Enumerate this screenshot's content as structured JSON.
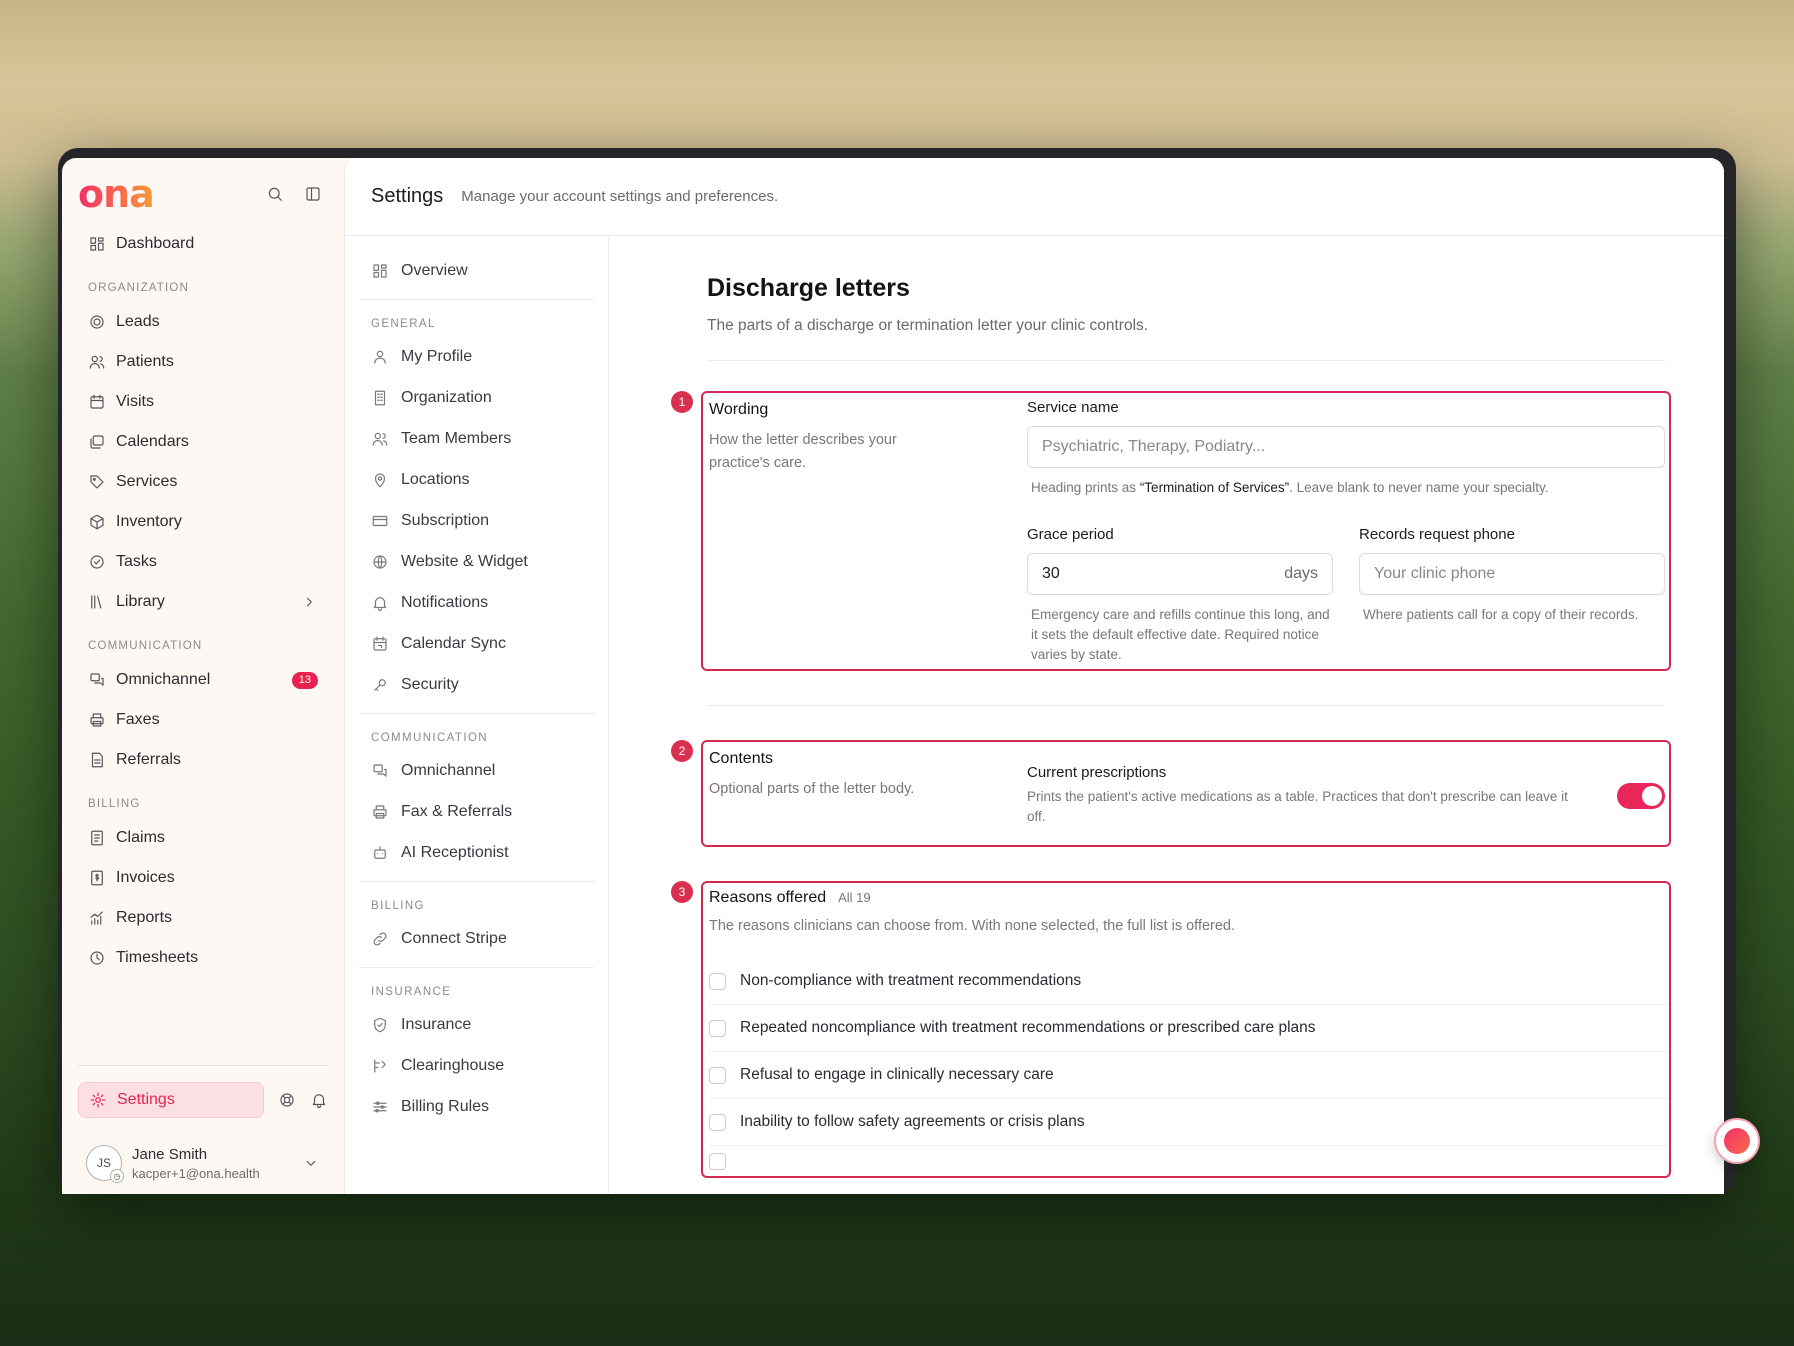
{
  "brand": {
    "logo": "ona"
  },
  "sidebar": {
    "dashboard": "Dashboard",
    "sections": [
      {
        "title": "ORGANIZATION",
        "items": [
          {
            "label": "Leads",
            "icon": "target-icon"
          },
          {
            "label": "Patients",
            "icon": "users-icon"
          },
          {
            "label": "Visits",
            "icon": "calendar-icon"
          },
          {
            "label": "Calendars",
            "icon": "calendars-icon"
          },
          {
            "label": "Services",
            "icon": "tag-icon"
          },
          {
            "label": "Inventory",
            "icon": "box-icon"
          },
          {
            "label": "Tasks",
            "icon": "check-circle-icon"
          },
          {
            "label": "Library",
            "icon": "library-icon"
          }
        ]
      },
      {
        "title": "COMMUNICATION",
        "items": [
          {
            "label": "Omnichannel",
            "icon": "chat-icon",
            "badge": "13"
          },
          {
            "label": "Faxes",
            "icon": "printer-icon"
          },
          {
            "label": "Referrals",
            "icon": "file-icon"
          }
        ]
      },
      {
        "title": "BILLING",
        "items": [
          {
            "label": "Claims",
            "icon": "file-list-icon"
          },
          {
            "label": "Invoices",
            "icon": "dollar-file-icon"
          },
          {
            "label": "Reports",
            "icon": "chart-icon"
          },
          {
            "label": "Timesheets",
            "icon": "clock-icon"
          }
        ]
      }
    ],
    "settings_label": "Settings",
    "user": {
      "initials": "JS",
      "name": "Jane Smith",
      "email": "kacper+1@ona.health"
    }
  },
  "header": {
    "title": "Settings",
    "subtitle": "Manage your account settings and preferences."
  },
  "subnav": {
    "overview": "Overview",
    "general_title": "GENERAL",
    "general": [
      "My Profile",
      "Organization",
      "Team Members",
      "Locations",
      "Subscription",
      "Website & Widget",
      "Notifications",
      "Calendar Sync",
      "Security"
    ],
    "communication_title": "COMMUNICATION",
    "communication": [
      "Omnichannel",
      "Fax & Referrals",
      "AI Receptionist"
    ],
    "billing_title": "BILLING",
    "billing": [
      "Connect Stripe"
    ],
    "insurance_title": "INSURANCE",
    "insurance": [
      "Insurance",
      "Clearinghouse",
      "Billing Rules"
    ]
  },
  "content": {
    "title": "Discharge letters",
    "subtitle": "The parts of a discharge or termination letter your clinic controls.",
    "wording": {
      "num": "1",
      "title": "Wording",
      "desc": "How the letter describes your practice's care.",
      "service_label": "Service name",
      "service_placeholder": "Psychiatric, Therapy, Podiatry...",
      "service_help_pre": "Heading prints as ",
      "service_help_bold": "“Termination of Services”",
      "service_help_post": ". Leave blank to never name your specialty.",
      "grace_label": "Grace period",
      "grace_value": "30",
      "grace_suffix": "days",
      "grace_help": "Emergency care and refills continue this long, and it sets the default effective date. Required notice varies by state.",
      "phone_label": "Records request phone",
      "phone_placeholder": "Your clinic phone",
      "phone_help": "Where patients call for a copy of their records."
    },
    "contents": {
      "num": "2",
      "title": "Contents",
      "desc": "Optional parts of the letter body.",
      "pres_label": "Current prescriptions",
      "pres_help": "Prints the patient's active medications as a table. Practices that don't prescribe can leave it off.",
      "pres_on": true
    },
    "reasons": {
      "num": "3",
      "title": "Reasons offered",
      "count": "All 19",
      "desc": "The reasons clinicians can choose from. With none selected, the full list is offered.",
      "items": [
        "Non-compliance with treatment recommendations",
        "Repeated noncompliance with treatment recommendations or prescribed care plans",
        "Refusal to engage in clinically necessary care",
        "Inability to follow safety agreements or crisis plans"
      ]
    }
  }
}
